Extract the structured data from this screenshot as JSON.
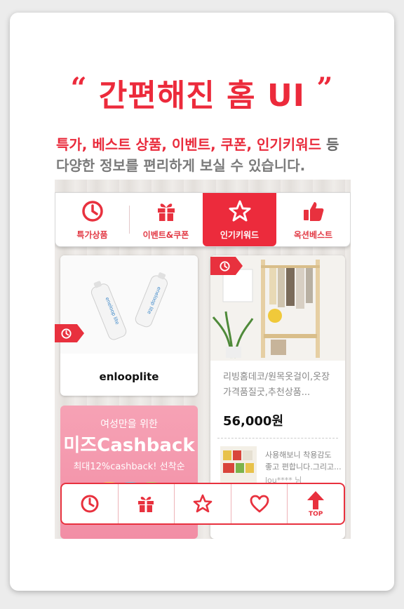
{
  "headline": {
    "open_quote": "“",
    "text": "간편해진 홈 UI",
    "close_quote": "”"
  },
  "subtitle": {
    "highlight": "특가, 베스트 상품, 이벤트, 쿠폰, 인기키워드",
    "rest": " 등",
    "line2": "다양한 정보를 편리하게 보실 수 있습니다."
  },
  "tabs": [
    {
      "label": "특가상품",
      "icon": "clock-icon",
      "active": false
    },
    {
      "label": "이벤트&쿠폰",
      "icon": "gift-icon",
      "active": false
    },
    {
      "label": "인기키워드",
      "icon": "star-icon",
      "active": true
    },
    {
      "label": "옥션베스트",
      "icon": "thumbs-up-icon",
      "active": false
    }
  ],
  "products": {
    "left": {
      "name": "enlooplite",
      "image": "battery-image"
    },
    "right": {
      "description_line1": "리빙홈데코/원목옷걸이,옷장",
      "description_line2": "가격품질굿,추천상품...",
      "price": "56,000원",
      "review_line1": "사용해보니 착용감도",
      "review_line2": "좋고 편합니다.그리고...",
      "reviewer": "lou**** 님"
    }
  },
  "promo": {
    "line1": "여성만을 위한",
    "line2": "미즈Cashback",
    "line3": "최대12%cashback! 선착순"
  },
  "bottom_bar": {
    "items": [
      "clock-icon",
      "gift-icon",
      "star-icon",
      "heart-icon",
      "top-arrow-icon"
    ],
    "top_label": "TOP"
  },
  "colors": {
    "accent": "#ec2b3c",
    "promo": "#f28ea5"
  }
}
